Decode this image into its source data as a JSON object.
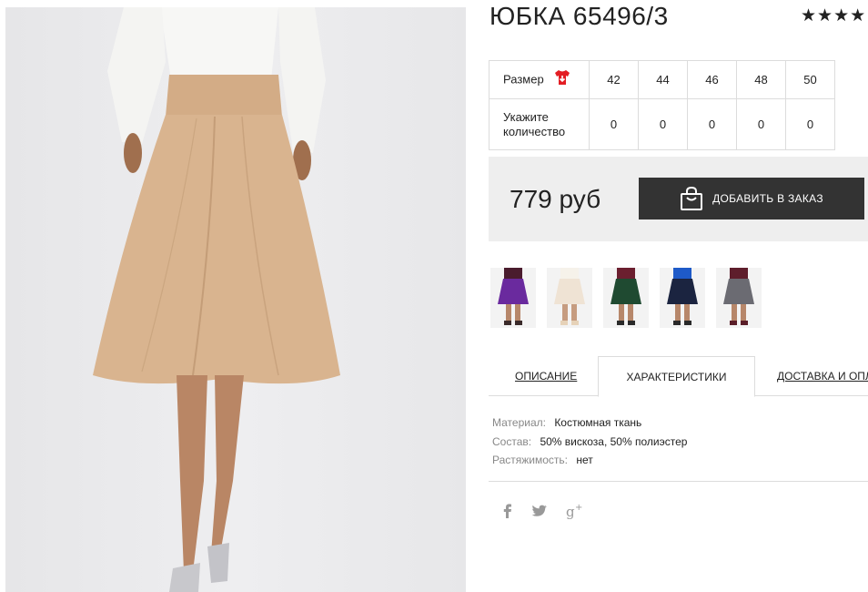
{
  "product": {
    "title": "ЮБКА 65496/3",
    "rating_stars": "★★★★",
    "rating_value": 4
  },
  "sizes": {
    "size_label": "Размер",
    "quantity_label_line1": "Укажите",
    "quantity_label_line2": "количество",
    "values": [
      "42",
      "44",
      "46",
      "48",
      "50"
    ],
    "quantities": [
      "0",
      "0",
      "0",
      "0",
      "0"
    ]
  },
  "price": {
    "amount": "779 руб",
    "button_label": "ДОБАВИТЬ В ЗАКАЗ"
  },
  "thumbnails": [
    {
      "icon": "skirt-purple-thumbnail",
      "color": "#6a2a9e"
    },
    {
      "icon": "skirt-cream-thumbnail",
      "color": "#efe3d4"
    },
    {
      "icon": "skirt-green-thumbnail",
      "color": "#1f4a31"
    },
    {
      "icon": "skirt-navy-thumbnail",
      "color": "#1b2440"
    },
    {
      "icon": "skirt-grey-thumbnail",
      "color": "#6b6b72"
    }
  ],
  "tabs": {
    "description": "ОПИСАНИЕ",
    "characteristics": "ХАРАКТЕРИСТИКИ",
    "delivery": "ДОСТАВКА И ОПЛ"
  },
  "specs": {
    "material_label": "Материал:",
    "material_value": "Костюмная ткань",
    "composition_label": "Состав:",
    "composition_value": "50% вискоза, 50% полиэстер",
    "stretch_label": "Растяжимость:",
    "stretch_value": "нет"
  },
  "social": [
    "facebook-icon",
    "twitter-icon",
    "google-plus-icon"
  ],
  "colors": {
    "button_bg": "#333333",
    "price_box_bg": "#eeeeee",
    "skirt_beige": "#d9b48f",
    "size_icon_red": "#e31e24"
  }
}
